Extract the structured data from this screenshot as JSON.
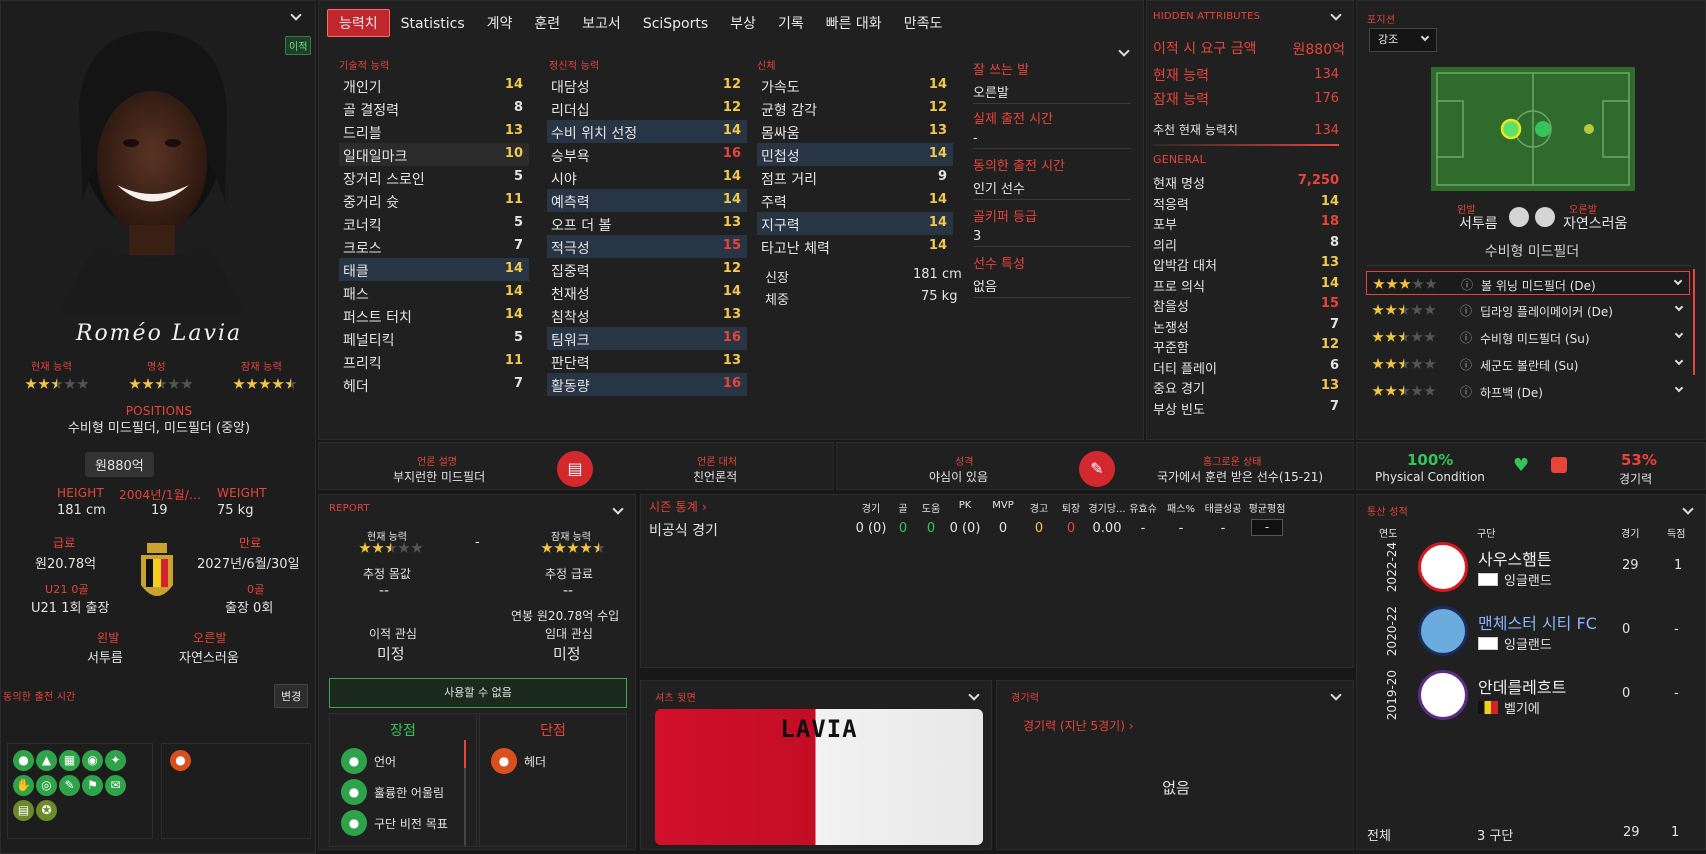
{
  "player": {
    "name": "Roméo Lavia",
    "badge": "이적",
    "ability_lbl": "현재 능력",
    "reputation_lbl": "명성",
    "potential_lbl": "잠재 능력",
    "ability_stars": 2.5,
    "reputation_stars": 2.5,
    "potential_stars": 4.5,
    "positions_lbl": "POSITIONS",
    "positions": "수비형 미드필더, 미드필더 (중앙)",
    "value": "원880억",
    "height_lbl": "HEIGHT",
    "height": "181 cm",
    "dob_lbl": "2004년/1월/...",
    "age": "19",
    "weight_lbl": "WEIGHT",
    "weight": "75 kg",
    "wage_lbl": "급료",
    "wage": "원20.78억",
    "contract_lbl": "만료",
    "contract": "2027년/6월/30일",
    "u21_lbl": "U21 0골",
    "u21": "U21 1회 출장",
    "caps_lbl": "0골",
    "caps": "출장 0회",
    "leftfoot_lbl": "왼발",
    "leftfoot": "서투름",
    "rightfoot_lbl": "오른발",
    "rightfoot": "자연스러움",
    "playtime_lbl": "동의한 출전 시간",
    "change_btn": "변경"
  },
  "tabs": [
    "능력치",
    "Statistics",
    "계약",
    "훈련",
    "보고서",
    "SciSports",
    "부상",
    "기록",
    "빠른 대화",
    "만족도"
  ],
  "technical": {
    "title": "기술적 능력",
    "items": [
      [
        "개인기",
        "14"
      ],
      [
        "골 결정력",
        "8"
      ],
      [
        "드리블",
        "13"
      ],
      [
        "일대일마크",
        "10"
      ],
      [
        "장거리 스로인",
        "5"
      ],
      [
        "중거리 슛",
        "11"
      ],
      [
        "코너킥",
        "5"
      ],
      [
        "크로스",
        "7"
      ],
      [
        "태클",
        "14"
      ],
      [
        "패스",
        "14"
      ],
      [
        "퍼스트 터치",
        "14"
      ],
      [
        "페널티킥",
        "5"
      ],
      [
        "프리킥",
        "11"
      ],
      [
        "헤더",
        "7"
      ]
    ]
  },
  "mental": {
    "title": "정신적 능력",
    "items": [
      [
        "대담성",
        "12"
      ],
      [
        "리더십",
        "12"
      ],
      [
        "수비 위치 선정",
        "14"
      ],
      [
        "승부욕",
        "16"
      ],
      [
        "시야",
        "14"
      ],
      [
        "예측력",
        "14"
      ],
      [
        "오프 더 볼",
        "13"
      ],
      [
        "적극성",
        "15"
      ],
      [
        "집중력",
        "12"
      ],
      [
        "천재성",
        "14"
      ],
      [
        "침착성",
        "13"
      ],
      [
        "팀워크",
        "16"
      ],
      [
        "판단력",
        "13"
      ],
      [
        "활동량",
        "16"
      ]
    ]
  },
  "physical": {
    "title": "신체",
    "items": [
      [
        "가속도",
        "14"
      ],
      [
        "균형 감각",
        "12"
      ],
      [
        "몸싸움",
        "13"
      ],
      [
        "민첩성",
        "14"
      ],
      [
        "점프 거리",
        "9"
      ],
      [
        "주력",
        "14"
      ],
      [
        "지구력",
        "14"
      ],
      [
        "타고난 체력",
        "14"
      ]
    ],
    "height_lbl": "신장",
    "height": "181 cm",
    "weight_lbl": "체중",
    "weight": "75 kg"
  },
  "info": {
    "foot_lbl": "잘 쓰는 발",
    "foot": "오른발",
    "realtime_lbl": "실제 출전 시간",
    "realtime": "-",
    "agreed_lbl": "동의한 출전 시간",
    "agreed": "인기 선수",
    "gk_lbl": "골키퍼 등급",
    "gk": "3",
    "traits_lbl": "선수 특성",
    "traits": "없음"
  },
  "hidden": {
    "title": "HIDDEN ATTRIBUTES",
    "fee_lbl": "이적 시 요구 금액",
    "fee": "원880억",
    "ca_lbl": "현재 능력",
    "ca": "134",
    "pa_lbl": "잠재 능력",
    "pa": "176",
    "rec_lbl": "추천 현재 능력치",
    "rec": "134",
    "general_lbl": "GENERAL",
    "items": [
      [
        "현재 명성",
        "7,250"
      ],
      [
        "적응력",
        "14"
      ],
      [
        "포부",
        "18"
      ],
      [
        "의리",
        "8"
      ],
      [
        "압박감 대처",
        "13"
      ],
      [
        "프로 의식",
        "14"
      ],
      [
        "참을성",
        "15"
      ],
      [
        "논쟁성",
        "7"
      ],
      [
        "꾸준함",
        "12"
      ],
      [
        "더티 플레이",
        "6"
      ],
      [
        "중요 경기",
        "13"
      ],
      [
        "부상 빈도",
        "7"
      ]
    ]
  },
  "position": {
    "title": "포지션",
    "dropdown": "강조",
    "leftfoot_lbl": "왼발",
    "leftfoot": "서투름",
    "rightfoot_lbl": "오른발",
    "rightfoot": "자연스러움",
    "role": "수비형 미드필더",
    "roles": [
      {
        "name": "볼 위닝 미드필더 (De)",
        "stars": 3
      },
      {
        "name": "딥라잉 플레이메이커 (De)",
        "stars": 2.5
      },
      {
        "name": "수비형 미드필더 (Su)",
        "stars": 2.5
      },
      {
        "name": "세군도 볼란테 (Su)",
        "stars": 2.5
      },
      {
        "name": "하프백 (De)",
        "stars": 2.5
      }
    ]
  },
  "media": {
    "desc_lbl": "언론 설명",
    "desc": "부지런한 미드필더",
    "handling_lbl": "언론 대처",
    "handling": "친언론적",
    "personality_lbl": "성격",
    "personality": "야심이 있음",
    "homegrown_lbl": "홈그로운 상태",
    "homegrown": "국가에서 훈련 받은 선수(15-21)"
  },
  "condition": {
    "physical": "100%",
    "physical_lbl": "Physical Condition",
    "sharpness": "53%",
    "sharpness_lbl": "경기력"
  },
  "report": {
    "title": "REPORT",
    "ca_lbl": "현재 능력",
    "ca_stars": 2.5,
    "dash": "-",
    "pa_lbl": "잠재 능력",
    "pa_stars": 4.5,
    "value_lbl": "추정 몸값",
    "value": "--",
    "wage_lbl": "추정 급료",
    "wage": "--",
    "wage_note": "연봉 원20.78억 수입",
    "transfer_lbl": "이적 관심",
    "transfer": "미정",
    "loan_lbl": "임대 관심",
    "loan": "미정",
    "unavailable": "사용할 수 없음",
    "pros_lbl": "장점",
    "cons_lbl": "단점",
    "pros": [
      "언어",
      "훌륭한 어울림",
      "구단 비전 목표"
    ],
    "cons": [
      "헤더"
    ]
  },
  "season": {
    "title": "시즌 통계",
    "cols": [
      "경기",
      "골",
      "도움",
      "PK",
      "MVP",
      "경고",
      "퇴장",
      "경기당...",
      "유효슈",
      "패스%",
      "태클성공",
      "평균평점"
    ],
    "row_lbl": "비공식 경기",
    "row": [
      "0 (0)",
      "0",
      "0",
      "0 (0)",
      "0",
      "0",
      "0",
      "0.00",
      "-",
      "-",
      "-",
      "-"
    ]
  },
  "shirt": {
    "title": "셔츠 뒷면",
    "name": "LAVIA"
  },
  "form": {
    "title": "경기력",
    "link": "경기력 (지난 5경기)",
    "empty": "없음"
  },
  "career": {
    "title": "통산 성적",
    "col_year": "연도",
    "col_club": "구단",
    "col_apps": "경기",
    "col_goals": "득점",
    "rows": [
      {
        "year": "2022-24",
        "club": "사우스햄튼",
        "country": "잉글랜드",
        "apps": "29",
        "goals": "1"
      },
      {
        "year": "2020-22",
        "club": "맨체스터 시티 FC",
        "country": "잉글랜드",
        "apps": "0",
        "goals": "-"
      },
      {
        "year": "2019-20",
        "club": "안데를레흐트",
        "country": "벨기에",
        "apps": "0",
        "goals": "-"
      }
    ],
    "total_lbl": "전체",
    "total_clubs": "3 구단",
    "total_apps": "29",
    "total_goals": "1"
  },
  "colors": {
    "accent": "#e8443a",
    "panel": "#202020",
    "bg": "#181818",
    "green": "#35c45b"
  }
}
